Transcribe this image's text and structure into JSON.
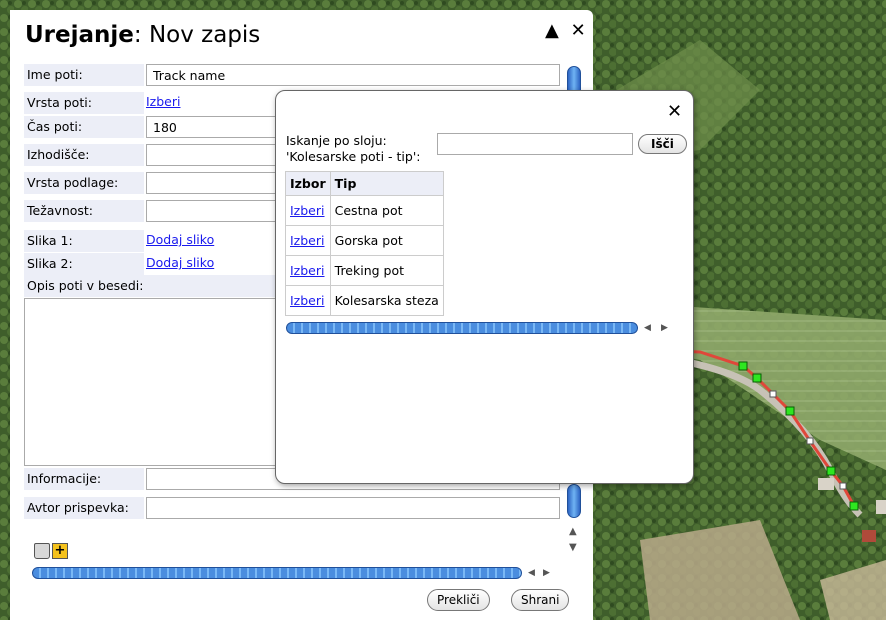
{
  "panel": {
    "title_bold": "Urejanje",
    "title_rest": ": Nov zapis",
    "collapse_icon": "▲",
    "close_icon": "✕"
  },
  "form": {
    "track_name_label": "Ime poti:",
    "track_name_value": "Track name",
    "track_type_label": "Vrsta poti:",
    "track_type_link": "Izberi",
    "track_time_label": "Čas poti:",
    "track_time_value": "180",
    "start_label": "Izhodišče:",
    "start_value": "",
    "surface_label": "Vrsta podlage:",
    "surface_value": "",
    "difficulty_label": "Težavnost:",
    "difficulty_value": "",
    "image1_label": "Slika 1:",
    "image1_link": "Dodaj sliko",
    "image2_label": "Slika 2:",
    "image2_link": "Dodaj sliko",
    "description_label": "Opis poti v besedi:",
    "description_value": "",
    "info_label": "Informacije:",
    "info_value": "",
    "author_label": "Avtor prispevka:",
    "author_value": ""
  },
  "tools": {
    "trash_icon": "trash-icon",
    "add_icon": "add-icon",
    "add_glyph": "+"
  },
  "footer": {
    "cancel_label": "Prekliči",
    "save_label": "Shrani"
  },
  "popup": {
    "close_icon": "✕",
    "search_label_line1": "Iskanje po sloju:",
    "search_label_line2": "'Kolesarske poti - tip':",
    "search_value": "",
    "search_button": "Išči",
    "table": {
      "headers": [
        "Izbor",
        "Tip"
      ],
      "rows": [
        {
          "select": "Izberi",
          "type": "Cestna pot"
        },
        {
          "select": "Izberi",
          "type": "Gorska pot"
        },
        {
          "select": "Izberi",
          "type": "Treking pot"
        },
        {
          "select": "Izberi",
          "type": "Kolesarska steza"
        }
      ]
    }
  },
  "colors": {
    "label_bg": "#eceef7",
    "link": "#1a1aee",
    "scroll_blue": "#4a8ddf",
    "track_red": "#e0473a",
    "vertex_green": "#2ee620"
  }
}
